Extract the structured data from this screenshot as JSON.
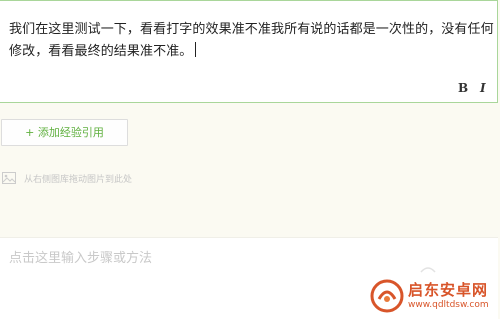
{
  "editor": {
    "content": "我们在这里测试一下，看看打字的效果准不准我所有说的话都是一次性的，没有任何修改，看看最终的结果准不准。",
    "bold_label": "B",
    "italic_label": "I"
  },
  "add_reference_button": {
    "label": "+ 添加经验引用"
  },
  "drag_hint": {
    "text": "从右侧图库拖动图片到此处",
    "icon": "image-icon"
  },
  "step_input": {
    "placeholder": "点击这里输入步骤或方法"
  },
  "watermark": {
    "name": "启东安卓网",
    "url": "www.qdltdsw.com",
    "color": "#d8552a"
  },
  "colors": {
    "editor_border": "#a9d69a",
    "accent_green": "#5fb03e",
    "background": "#fbfaf2"
  }
}
